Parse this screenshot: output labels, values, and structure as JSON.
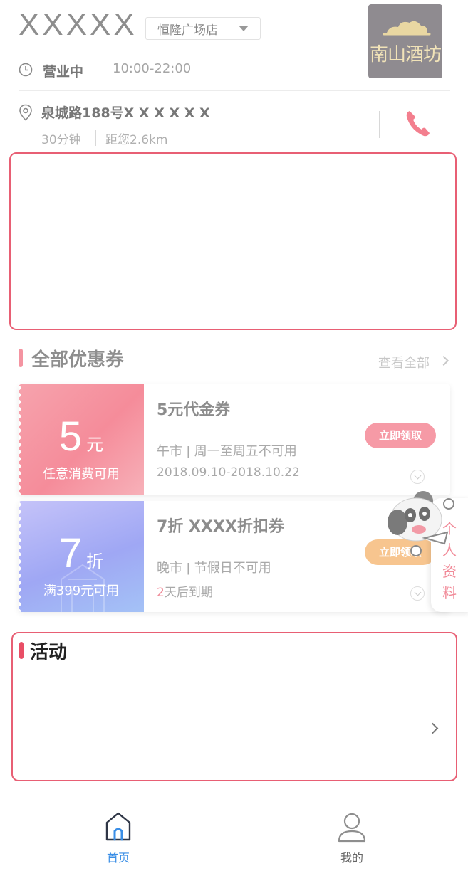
{
  "header": {
    "store_name": "XXXXX",
    "branch": "恒隆广场店",
    "logo_text": "南山酒坊",
    "status": "营业中",
    "hours": "10:00-22:00",
    "address": "泉城路188号X X X X X X",
    "duration": "30分钟",
    "distance": "距您2.6km"
  },
  "coupons": {
    "title": "全部优惠券",
    "view_all": "查看全部",
    "items": [
      {
        "amount": "5",
        "unit": "元",
        "condition": "任意消费可用",
        "title": "5元代金券",
        "rule": "午市 ǀ 周一至周五不可用",
        "date_highlight": "",
        "date_rest": "2018.09.10-2018.10.22",
        "claim": "立即领取"
      },
      {
        "amount": "7",
        "unit": "折",
        "condition": "满399元可用",
        "title": "7折 XXXX折扣券",
        "rule": "晚市 ǀ 节假日不可用",
        "date_highlight": "2",
        "date_rest": "天后到期",
        "claim": "立即领取"
      }
    ]
  },
  "float_tab": {
    "label": "个人资料"
  },
  "activity": {
    "title": "活动"
  },
  "tabbar": {
    "home": "首页",
    "mine": "我的"
  },
  "colors": {
    "accent": "#e85f74",
    "active_tab": "#3a8ee6",
    "coupon_pink": "#f58c9a",
    "coupon_purple": "#9fa7f4"
  }
}
